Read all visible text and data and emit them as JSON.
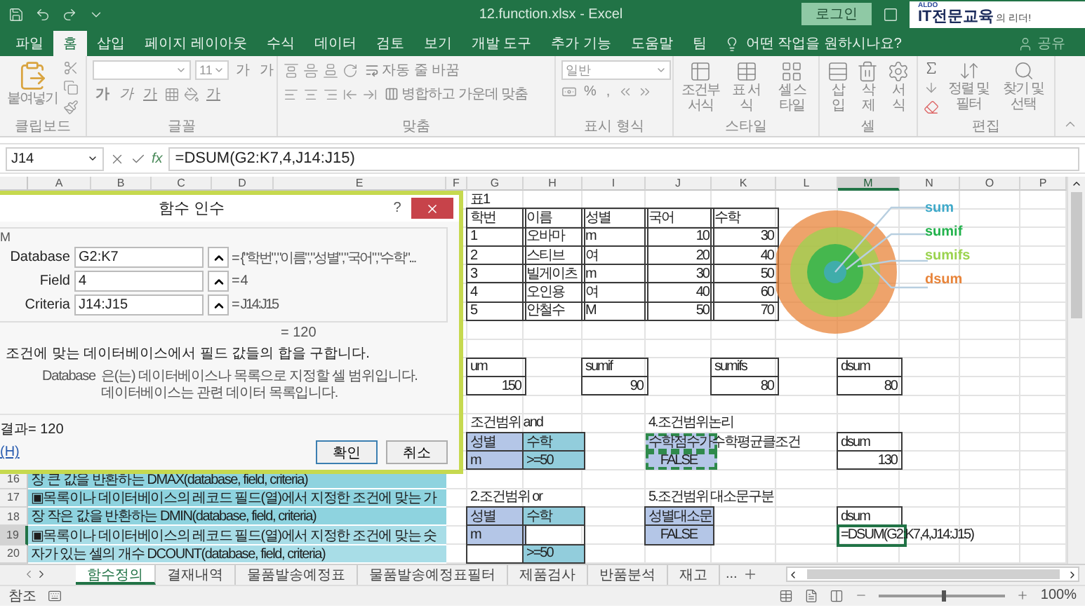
{
  "title_bar": {
    "file_title": "12.function.xlsx - Excel",
    "login": "로그인",
    "logo": {
      "small": "ALDO",
      "main": "IT전문교육",
      "tail": "의 리더!"
    }
  },
  "ribbon_tabs": [
    {
      "label": "파일",
      "selected": false
    },
    {
      "label": "홈",
      "selected": true
    },
    {
      "label": "삽입",
      "selected": false
    },
    {
      "label": "페이지 레이아웃",
      "selected": false
    },
    {
      "label": "수식",
      "selected": false
    },
    {
      "label": "데이터",
      "selected": false
    },
    {
      "label": "검토",
      "selected": false
    },
    {
      "label": "보기",
      "selected": false
    },
    {
      "label": "개발 도구",
      "selected": false
    },
    {
      "label": "추가 기능",
      "selected": false
    },
    {
      "label": "도움말",
      "selected": false
    },
    {
      "label": "팀",
      "selected": false
    }
  ],
  "tell_me": "어떤 작업을 원하시나요?",
  "share": "공유",
  "ribbon": {
    "clipboard": {
      "label": "클립보드",
      "paste": "붙여넣기"
    },
    "font": {
      "label": "글꼴",
      "size": "11",
      "grow": "가",
      "shrink": "가",
      "bold": "가",
      "italic": "가",
      "underline": "가",
      "font_color_button": "가"
    },
    "alignment": {
      "label": "맞춤",
      "wrap": "자동 줄 바꿈",
      "merge": "병합하고 가운데 맞춤"
    },
    "number": {
      "label": "표시 형식",
      "format": "일반",
      "percent": "%",
      "comma": ","
    },
    "styles": {
      "label": "스타일",
      "buttons": [
        "조건부 서식",
        "표 서식",
        "셀 스타일"
      ]
    },
    "cells": {
      "label": "셀",
      "buttons": [
        "삽입",
        "삭제",
        "서식"
      ]
    },
    "editing": {
      "label": "편집",
      "buttons": [
        "정렬 및 필터",
        "찾기 및 선택"
      ]
    }
  },
  "formula_bar": {
    "name_box": "J14",
    "fx": "fx",
    "formula": "=DSUM(G2:K7,4,J14:J15)"
  },
  "columns": [
    {
      "label": "A",
      "selected": false
    },
    {
      "label": "B",
      "selected": false
    },
    {
      "label": "C",
      "selected": false
    },
    {
      "label": "D",
      "selected": false
    },
    {
      "label": "E",
      "selected": false
    },
    {
      "label": "F",
      "selected": false
    },
    {
      "label": "G",
      "selected": false
    },
    {
      "label": "H",
      "selected": false
    },
    {
      "label": "I",
      "selected": false
    },
    {
      "label": "J",
      "selected": false
    },
    {
      "label": "K",
      "selected": false
    },
    {
      "label": "L",
      "selected": false
    },
    {
      "label": "M",
      "selected": true
    },
    {
      "label": "N",
      "selected": false
    },
    {
      "label": "O",
      "selected": false
    },
    {
      "label": "P",
      "selected": false
    }
  ],
  "dialog": {
    "title": "함수 인수",
    "help": "?",
    "function": "M",
    "args": [
      {
        "name": "Database",
        "value": "G2:K7",
        "result": "= {\"학번\",\"이름\",\"성별\",\"국어\",\"수학\"..."
      },
      {
        "name": "Field",
        "value": "4",
        "result": "= 4"
      },
      {
        "name": "Criteria",
        "value": "J14:J15",
        "result": "= J14:J15"
      }
    ],
    "total": "= 120",
    "description": "조건에 맞는 데이터베이스에서 필드 값들의 합을 구합니다.",
    "arg_name": "Database",
    "arg_help": [
      "은(는) 데이터베이스나 목록으로 지정할 셀 범위입니다.",
      "데이터베이스는 관련 데이터 목록입니다."
    ],
    "result": "결과= 120",
    "help_link": "(H)",
    "buttons": [
      "확인",
      "취소"
    ]
  },
  "notes": [
    {
      "number": "16",
      "selected": false,
      "text": "장 큰 값을 반환하는 DMAX(database, field, criteria)"
    },
    {
      "number": "17",
      "selected": false,
      "text": "▣목록이나 데이터베이스의 레코드 필드(열)에서 지정한 조건에 맞는 가"
    },
    {
      "number": "18",
      "selected": false,
      "text": "장 작은 값을 반환하는 DMIN(database, field, criteria)"
    },
    {
      "number": "19",
      "selected": true,
      "text": "▣목록이나 데이터베이스의 레코드 필드(열)에서 지정한 조건에 맞는 숫"
    },
    {
      "number": "20",
      "selected": false,
      "text": "자가 있는 셀의 개수 DCOUNT(database, field, criteria)"
    }
  ],
  "grid": [
    [
      {
        "text": "표1",
        "kind": "plain"
      }
    ],
    [
      {
        "text": "학번",
        "kind": "table"
      },
      {
        "text": "이름",
        "kind": "table"
      },
      {
        "text": "성별",
        "kind": "table"
      },
      {
        "text": "국어",
        "kind": "table"
      },
      {
        "text": "수학",
        "kind": "table"
      }
    ],
    [
      {
        "text": "1",
        "kind": "table"
      },
      {
        "text": "오바마",
        "kind": "table"
      },
      {
        "text": "m",
        "kind": "table"
      },
      {
        "text": "10",
        "kind": "tablenum"
      },
      {
        "text": "30",
        "kind": "tablenum"
      }
    ],
    [
      {
        "text": "2",
        "kind": "table"
      },
      {
        "text": "스티브",
        "kind": "table"
      },
      {
        "text": "여",
        "kind": "table"
      },
      {
        "text": "20",
        "kind": "tablenum"
      },
      {
        "text": "40",
        "kind": "tablenum"
      }
    ],
    [
      {
        "text": "3",
        "kind": "table"
      },
      {
        "text": "빌게이츠",
        "kind": "table"
      },
      {
        "text": "m",
        "kind": "table"
      },
      {
        "text": "30",
        "kind": "tablenum"
      },
      {
        "text": "50",
        "kind": "tablenum"
      }
    ],
    [
      {
        "text": "4",
        "kind": "table"
      },
      {
        "text": "오인용",
        "kind": "table"
      },
      {
        "text": "여",
        "kind": "table"
      },
      {
        "text": "40",
        "kind": "tablenum"
      },
      {
        "text": "60",
        "kind": "tablenum"
      }
    ],
    [
      {
        "text": "5",
        "kind": "table"
      },
      {
        "text": "안철수",
        "kind": "table"
      },
      {
        "text": "M",
        "kind": "table"
      },
      {
        "text": "50",
        "kind": "tablenum"
      },
      {
        "text": "70",
        "kind": "tablenum"
      }
    ],
    [
      {
        "kind": "blank"
      }
    ],
    [
      {
        "kind": "blank"
      }
    ],
    [
      {
        "text": "um",
        "kind": "boxed"
      },
      {
        "kind": "blank"
      },
      {
        "text": "sumif",
        "kind": "boxed"
      },
      {
        "kind": "blank"
      },
      {
        "text": "sumifs",
        "kind": "boxed"
      },
      {
        "kind": "blank"
      },
      {
        "text": "dsum",
        "kind": "boxed"
      }
    ],
    [
      {
        "text": "150",
        "kind": "boxednum"
      },
      {
        "kind": "blank"
      },
      {
        "text": "90",
        "kind": "boxednum"
      },
      {
        "kind": "blank"
      },
      {
        "text": "80",
        "kind": "boxednum"
      },
      {
        "kind": "blank"
      },
      {
        "text": "80",
        "kind": "boxednum"
      }
    ],
    [
      {
        "kind": "blank"
      }
    ],
    [
      {
        "text": "조건범위 and",
        "kind": "plain"
      },
      {
        "kind": "blank"
      },
      {
        "kind": "blank"
      },
      {
        "text": "4.조건범위논리",
        "kind": "plain"
      }
    ],
    [
      {
        "text": "성별",
        "kind": "blue"
      },
      {
        "text": "수학",
        "kind": "teal"
      },
      {
        "kind": "blank"
      },
      {
        "text": "수학점수가수학평균클조건",
        "kind": "marked"
      },
      {
        "kind": "blank"
      },
      {
        "kind": "blank"
      },
      {
        "text": "dsum",
        "kind": "boxed"
      }
    ],
    [
      {
        "text": "m",
        "kind": "blue"
      },
      {
        "text": ">=50",
        "kind": "teal"
      },
      {
        "kind": "blank"
      },
      {
        "text": "FALSE",
        "kind": "markedcenter"
      },
      {
        "kind": "blank"
      },
      {
        "kind": "blank"
      },
      {
        "text": "130",
        "kind": "boxednum"
      }
    ],
    [
      {
        "kind": "blank"
      }
    ],
    [
      {
        "text": "2.조건범위 or",
        "kind": "plain"
      },
      {
        "kind": "blank"
      },
      {
        "kind": "blank"
      },
      {
        "text": "5.조건범위 대소문구분",
        "kind": "plain"
      }
    ],
    [
      {
        "text": "성별",
        "kind": "blue"
      },
      {
        "text": "수학",
        "kind": "teal"
      },
      {
        "kind": "blank"
      },
      {
        "text": "성별대소문",
        "kind": "blue"
      },
      {
        "kind": "blank"
      },
      {
        "kind": "blank"
      },
      {
        "text": "dsum",
        "kind": "boxed"
      }
    ],
    [
      {
        "text": "m",
        "kind": "blue"
      },
      {
        "kind": "boxed"
      },
      {
        "kind": "blank"
      },
      {
        "text": "FALSE",
        "kind": "bluecenter"
      },
      {
        "kind": "blank"
      },
      {
        "kind": "blank"
      },
      {
        "text": "=DSUM(G2:K7,4,J14:J15)",
        "kind": "active"
      }
    ],
    [
      {
        "kind": "boxed"
      },
      {
        "text": ">=50",
        "kind": "teal"
      }
    ]
  ],
  "chart": {
    "labels": [
      {
        "text": "sum",
        "color": "#3fa9c9"
      },
      {
        "text": "sumif",
        "color": "#22b24c"
      },
      {
        "text": "sumifs",
        "color": "#9bd34f"
      },
      {
        "text": "dsum",
        "color": "#e8843a"
      }
    ]
  },
  "sheet_tabs": [
    {
      "label": "함수정의",
      "selected": true
    },
    {
      "label": "결재내역",
      "selected": false
    },
    {
      "label": "물품발송예정표",
      "selected": false
    },
    {
      "label": "물품발송예정표필터",
      "selected": false
    },
    {
      "label": "제품검사",
      "selected": false
    },
    {
      "label": "반품분석",
      "selected": false
    },
    {
      "label": "재고",
      "selected": false
    }
  ],
  "more_tabs": "...",
  "status_bar": {
    "mode": "참조",
    "zoom_slider": {
      "level": 0.5
    },
    "zoom": "100%"
  }
}
